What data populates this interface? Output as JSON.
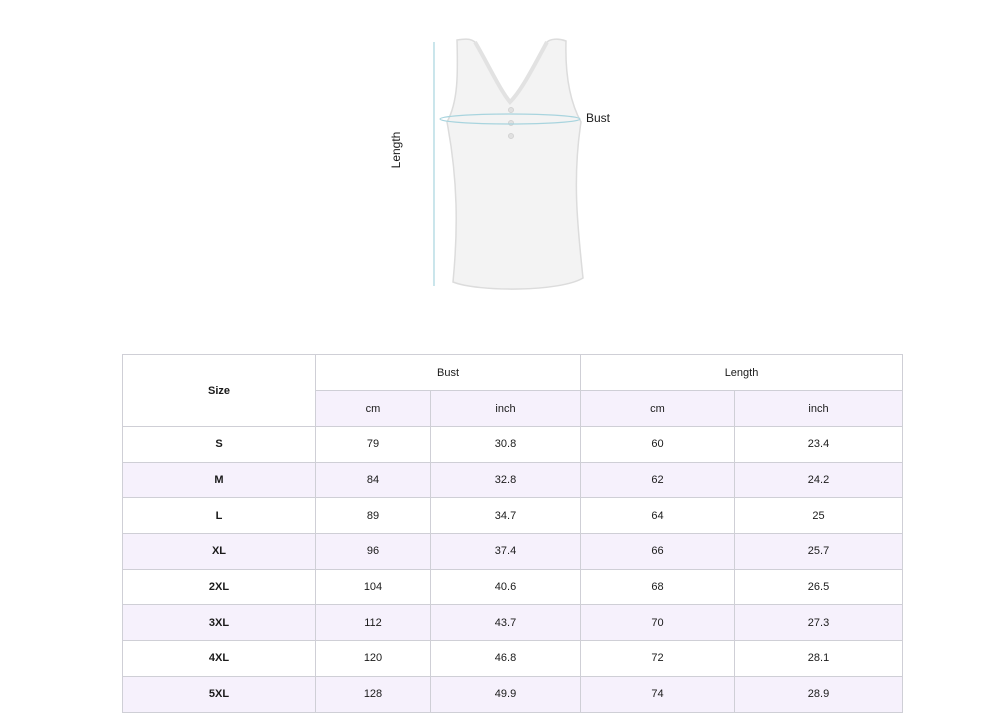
{
  "diagram": {
    "length_label": "Length",
    "bust_label": "Bust"
  },
  "table": {
    "size_header": "Size",
    "bust_header": "Bust",
    "length_header": "Length",
    "units": [
      "cm",
      "inch",
      "cm",
      "inch"
    ],
    "rows": [
      {
        "size": "S",
        "bust_cm": "79",
        "bust_inch": "30.8",
        "length_cm": "60",
        "length_inch": "23.4"
      },
      {
        "size": "M",
        "bust_cm": "84",
        "bust_inch": "32.8",
        "length_cm": "62",
        "length_inch": "24.2"
      },
      {
        "size": "L",
        "bust_cm": "89",
        "bust_inch": "34.7",
        "length_cm": "64",
        "length_inch": "25"
      },
      {
        "size": "XL",
        "bust_cm": "96",
        "bust_inch": "37.4",
        "length_cm": "66",
        "length_inch": "25.7"
      },
      {
        "size": "2XL",
        "bust_cm": "104",
        "bust_inch": "40.6",
        "length_cm": "68",
        "length_inch": "26.5"
      },
      {
        "size": "3XL",
        "bust_cm": "112",
        "bust_inch": "43.7",
        "length_cm": "70",
        "length_inch": "27.3"
      },
      {
        "size": "4XL",
        "bust_cm": "120",
        "bust_inch": "46.8",
        "length_cm": "72",
        "length_inch": "28.1"
      },
      {
        "size": "5XL",
        "bust_cm": "128",
        "bust_inch": "49.9",
        "length_cm": "74",
        "length_inch": "28.9"
      }
    ]
  },
  "colors": {
    "measure_line": "#a8d4de",
    "alt_row": "#f6f1fc",
    "border": "#cfcfd6"
  }
}
